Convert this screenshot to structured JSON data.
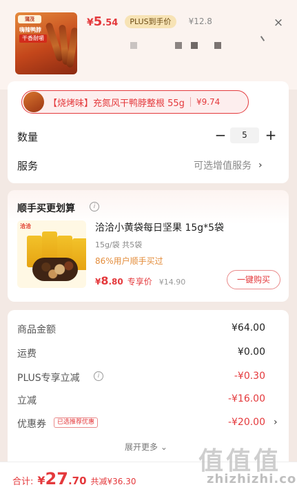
{
  "header": {
    "price_yen": "¥",
    "price_int": "5",
    "price_dec": ".54",
    "plus_tag": "PLUS到手价",
    "original_price": "¥12.8",
    "close_icon": "×",
    "thumb_brand": "蒲茂",
    "thumb_title": "嗨辣鸭脖",
    "thumb_sub": "干香耐嚼"
  },
  "spec": {
    "label": "【烧烤味】充氮风干鸭脖整根 55g",
    "price": "¥9.74"
  },
  "quantity": {
    "label": "数量",
    "minus": "−",
    "value": "5",
    "plus": "+"
  },
  "service": {
    "label": "服务",
    "option": "可选增值服务",
    "chevron": "›"
  },
  "addon": {
    "title": "顺手买更划算",
    "info": "i",
    "logo": "洽洽",
    "product_name": "洽洽小黄袋每日坚果 15g*5袋",
    "spec": "15g/袋 共5袋",
    "buyers": "86%用户顺手买过",
    "price_yen": "¥",
    "price_int": "8",
    "price_dec": ".80",
    "exclusive": "专享价",
    "original": "¥14.90",
    "buy_button": "一键购买"
  },
  "summary": {
    "goods_label": "商品金额",
    "goods_value": "¥64.00",
    "shipping_label": "运费",
    "shipping_value": "¥0.00",
    "plus_label": "PLUS专享立减",
    "plus_info": "i",
    "plus_value": "-¥0.30",
    "discount_label": "立减",
    "discount_value": "-¥16.00",
    "coupon_label": "优惠券",
    "coupon_tag": "已选推荐优惠",
    "coupon_value": "-¥20.00",
    "coupon_chevron": "›",
    "expand": "展开更多 ⌄"
  },
  "footer": {
    "total_label": "合计:",
    "total_yen": "¥",
    "total_int": "27",
    "total_dec": ".70",
    "saved": "共减¥36.30"
  },
  "watermark": {
    "symbol": "值值值",
    "text": "zhizhizhi.com"
  },
  "colors": {
    "accent": "#e4393c",
    "plus_tag_bg": "#f7e3b5",
    "buyers_orange": "#e38c3a",
    "page_bg": "#f3e9e4"
  }
}
